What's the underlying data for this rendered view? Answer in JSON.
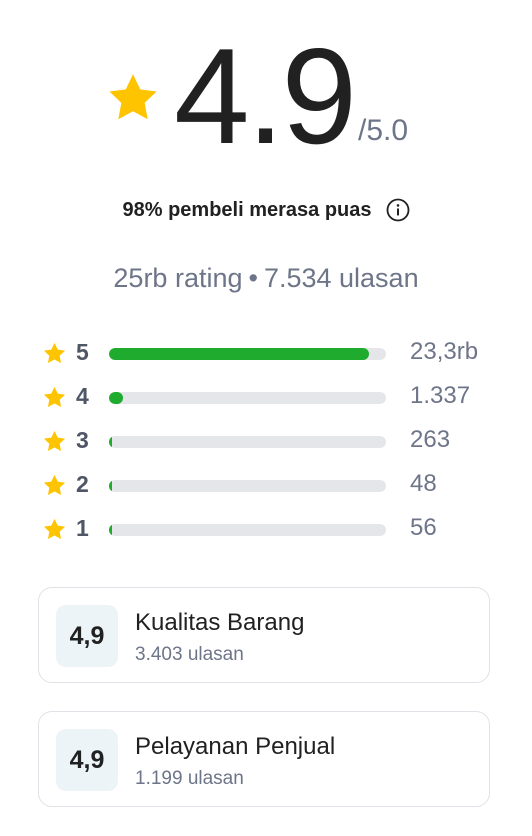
{
  "rating": {
    "icon": "star-icon",
    "star_color": "#FFC400",
    "score": "4.9",
    "max": "/5.0",
    "satisfaction": "98% pembeli merasa puas",
    "info_icon": "info-icon",
    "total_ratings": "25rb rating",
    "separator": "•",
    "total_reviews": "7.534 ulasan"
  },
  "distribution": {
    "bar_color": "#1FAB2D",
    "track_color": "#E4E6E9",
    "rows": [
      {
        "stars": "5",
        "count": "23,3rb",
        "fill_pct": 94
      },
      {
        "stars": "4",
        "count": "1.337",
        "fill_pct": 5
      },
      {
        "stars": "3",
        "count": "263",
        "fill_pct": 1
      },
      {
        "stars": "2",
        "count": "48",
        "fill_pct": 0.5
      },
      {
        "stars": "1",
        "count": "56",
        "fill_pct": 0.5
      }
    ]
  },
  "aspects": [
    {
      "score": "4,9",
      "title": "Kualitas Barang",
      "reviews": "3.403 ulasan"
    },
    {
      "score": "4,9",
      "title": "Pelayanan Penjual",
      "reviews": "1.199 ulasan"
    }
  ]
}
